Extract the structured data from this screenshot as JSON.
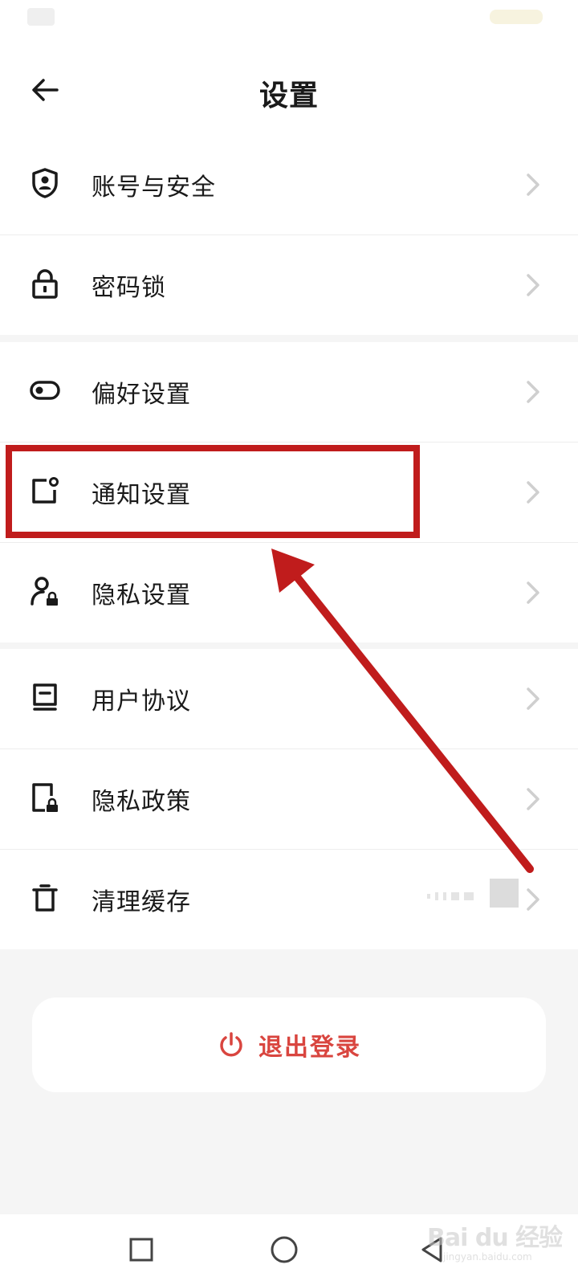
{
  "header": {
    "title": "设置"
  },
  "groups": [
    {
      "items": [
        {
          "label": "账号与安全",
          "icon": "shield-user-icon"
        },
        {
          "label": "密码锁",
          "icon": "lock-icon"
        }
      ]
    },
    {
      "items": [
        {
          "label": "偏好设置",
          "icon": "toggle-icon"
        },
        {
          "label": "通知设置",
          "icon": "notification-icon"
        },
        {
          "label": "隐私设置",
          "icon": "user-lock-icon"
        }
      ]
    },
    {
      "items": [
        {
          "label": "用户协议",
          "icon": "book-icon"
        },
        {
          "label": "隐私政策",
          "icon": "document-lock-icon"
        },
        {
          "label": "清理缓存",
          "icon": "trash-icon"
        }
      ]
    }
  ],
  "logout": {
    "label": "退出登录",
    "color": "#d9453f",
    "icon": "power-icon"
  },
  "annotation": {
    "highlighted_item": "通知设置",
    "color": "#c01c1c"
  },
  "watermark": {
    "text": "Bai du 经验",
    "sub": "jingyan.baidu.com"
  }
}
